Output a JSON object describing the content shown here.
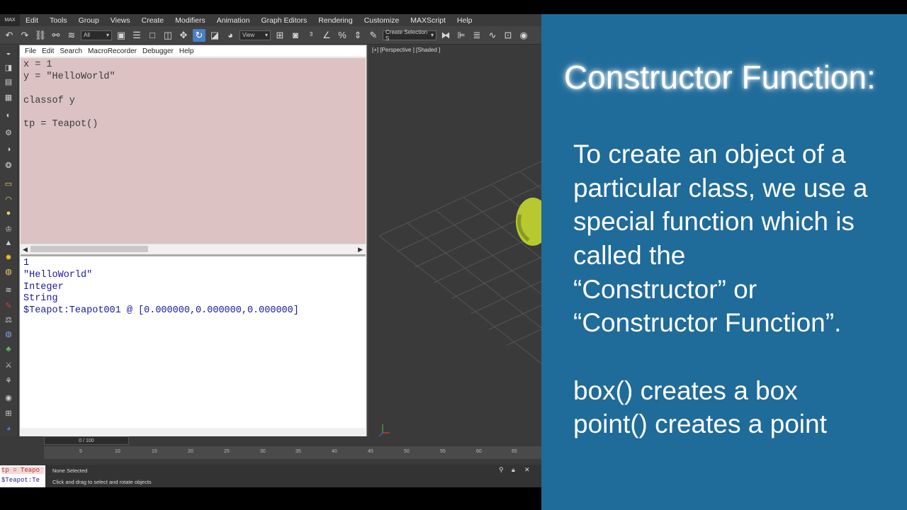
{
  "menubar": {
    "logo": "MAX",
    "items": [
      "Edit",
      "Tools",
      "Group",
      "Views",
      "Create",
      "Modifiers",
      "Animation",
      "Graph Editors",
      "Rendering",
      "Customize",
      "MAXScript",
      "Help"
    ]
  },
  "toolbar": {
    "selection_filter": "All",
    "reference_coord": "View",
    "named_selection": "Create Selection S"
  },
  "editor": {
    "menu": [
      "File",
      "Edit",
      "Search",
      "MacroRecorder",
      "Debugger",
      "Help"
    ],
    "script_lines": [
      "x = 1",
      "y = \"HelloWorld\"",
      "",
      "classof y",
      "",
      "tp = Teapot()"
    ],
    "output_lines": [
      "1",
      "\"HelloWorld\"",
      "Integer",
      "String",
      "$Teapot:Teapot001 @ [0.000000,0.000000,0.000000]"
    ]
  },
  "viewport": {
    "label": "[+] [Perspective ] [Shaded ]"
  },
  "timeline": {
    "slider": "0 / 100",
    "ticks": [
      "5",
      "10",
      "15",
      "20",
      "25",
      "30",
      "35",
      "40",
      "45",
      "50",
      "55",
      "60",
      "65"
    ]
  },
  "status": {
    "listener_line1": "tp = Teapo",
    "listener_line2": "$Teapot:Te",
    "selection": "None Selected",
    "prompt": "Click and drag to select and rotate objects"
  },
  "slide": {
    "title": "Constructor Function:",
    "lines": [
      "To create an object of a",
      "particular class, we use a",
      "special function which is",
      "called the",
      "“Constructor” or",
      "“Constructor Function”.",
      "",
      "box() creates a box",
      "point() creates a point"
    ],
    "background": "#1f6b9a"
  }
}
